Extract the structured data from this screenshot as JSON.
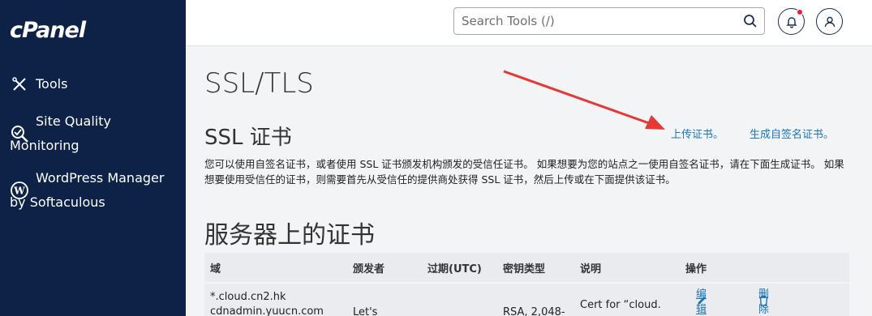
{
  "app": {
    "logo_text": "cPanel"
  },
  "sidebar": {
    "items": [
      {
        "label": "Tools",
        "icon": "tools-icon"
      },
      {
        "label": "Site Quality Monitoring",
        "icon": "site-quality-icon"
      },
      {
        "label": "WordPress Manager by Softaculous",
        "icon": "wordpress-icon"
      }
    ]
  },
  "header": {
    "search_placeholder": "Search Tools (/)",
    "notification_badge_color": "#e0203a"
  },
  "main": {
    "page_title": "SSL/TLS",
    "section_title": "SSL 证书",
    "upload_link": "上传证书。",
    "generate_link": "生成自签名证书。",
    "description": "您可以使用自签名证书，或者使用 SSL 证书颁发机构颁发的受信任证书。 如果想要为您的站点之一使用自签名证书，请在下面生成证书。 如果想要使用受信任的证书，则需要首先从受信任的提供商处获得 SSL 证书，然后上传或在下面提供该证书。",
    "certs_heading": "服务器上的证书",
    "table": {
      "headers": [
        "域",
        "颁发者",
        "过期(UTC)",
        "密钥类型",
        "说明",
        "操作"
      ],
      "rows": [
        {
          "domain_line1": "*.cloud.cn2.hk",
          "domain_line2": "cdnadmin.yuucn.com",
          "issuer": "Let's",
          "expiry": "",
          "key_type": "RSA, 2,048-",
          "description": "Cert for “cloud.",
          "edit": "编辑",
          "delete": "删除"
        }
      ]
    }
  },
  "colors": {
    "sidebar_bg": "#0e2248",
    "link": "#1b75bb",
    "annotation_arrow": "#e53935"
  }
}
